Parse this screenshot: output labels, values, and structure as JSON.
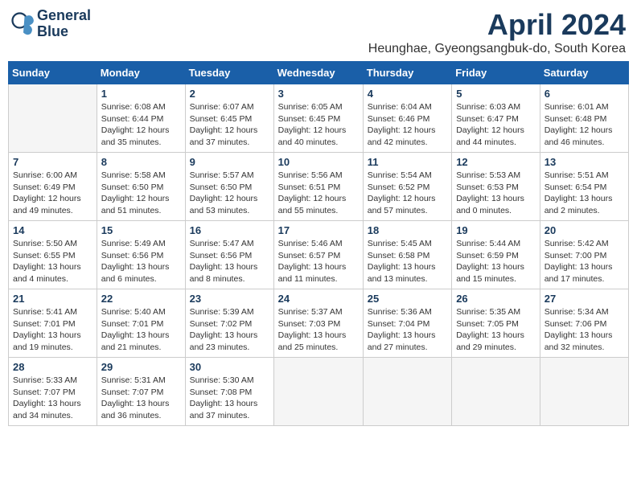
{
  "logo": {
    "line1": "General",
    "line2": "Blue"
  },
  "title": "April 2024",
  "location": "Heunghae, Gyeongsangbuk-do, South Korea",
  "days_of_week": [
    "Sunday",
    "Monday",
    "Tuesday",
    "Wednesday",
    "Thursday",
    "Friday",
    "Saturday"
  ],
  "weeks": [
    [
      {
        "day": "",
        "info": ""
      },
      {
        "day": "1",
        "info": "Sunrise: 6:08 AM\nSunset: 6:44 PM\nDaylight: 12 hours\nand 35 minutes."
      },
      {
        "day": "2",
        "info": "Sunrise: 6:07 AM\nSunset: 6:45 PM\nDaylight: 12 hours\nand 37 minutes."
      },
      {
        "day": "3",
        "info": "Sunrise: 6:05 AM\nSunset: 6:45 PM\nDaylight: 12 hours\nand 40 minutes."
      },
      {
        "day": "4",
        "info": "Sunrise: 6:04 AM\nSunset: 6:46 PM\nDaylight: 12 hours\nand 42 minutes."
      },
      {
        "day": "5",
        "info": "Sunrise: 6:03 AM\nSunset: 6:47 PM\nDaylight: 12 hours\nand 44 minutes."
      },
      {
        "day": "6",
        "info": "Sunrise: 6:01 AM\nSunset: 6:48 PM\nDaylight: 12 hours\nand 46 minutes."
      }
    ],
    [
      {
        "day": "7",
        "info": "Sunrise: 6:00 AM\nSunset: 6:49 PM\nDaylight: 12 hours\nand 49 minutes."
      },
      {
        "day": "8",
        "info": "Sunrise: 5:58 AM\nSunset: 6:50 PM\nDaylight: 12 hours\nand 51 minutes."
      },
      {
        "day": "9",
        "info": "Sunrise: 5:57 AM\nSunset: 6:50 PM\nDaylight: 12 hours\nand 53 minutes."
      },
      {
        "day": "10",
        "info": "Sunrise: 5:56 AM\nSunset: 6:51 PM\nDaylight: 12 hours\nand 55 minutes."
      },
      {
        "day": "11",
        "info": "Sunrise: 5:54 AM\nSunset: 6:52 PM\nDaylight: 12 hours\nand 57 minutes."
      },
      {
        "day": "12",
        "info": "Sunrise: 5:53 AM\nSunset: 6:53 PM\nDaylight: 13 hours\nand 0 minutes."
      },
      {
        "day": "13",
        "info": "Sunrise: 5:51 AM\nSunset: 6:54 PM\nDaylight: 13 hours\nand 2 minutes."
      }
    ],
    [
      {
        "day": "14",
        "info": "Sunrise: 5:50 AM\nSunset: 6:55 PM\nDaylight: 13 hours\nand 4 minutes."
      },
      {
        "day": "15",
        "info": "Sunrise: 5:49 AM\nSunset: 6:56 PM\nDaylight: 13 hours\nand 6 minutes."
      },
      {
        "day": "16",
        "info": "Sunrise: 5:47 AM\nSunset: 6:56 PM\nDaylight: 13 hours\nand 8 minutes."
      },
      {
        "day": "17",
        "info": "Sunrise: 5:46 AM\nSunset: 6:57 PM\nDaylight: 13 hours\nand 11 minutes."
      },
      {
        "day": "18",
        "info": "Sunrise: 5:45 AM\nSunset: 6:58 PM\nDaylight: 13 hours\nand 13 minutes."
      },
      {
        "day": "19",
        "info": "Sunrise: 5:44 AM\nSunset: 6:59 PM\nDaylight: 13 hours\nand 15 minutes."
      },
      {
        "day": "20",
        "info": "Sunrise: 5:42 AM\nSunset: 7:00 PM\nDaylight: 13 hours\nand 17 minutes."
      }
    ],
    [
      {
        "day": "21",
        "info": "Sunrise: 5:41 AM\nSunset: 7:01 PM\nDaylight: 13 hours\nand 19 minutes."
      },
      {
        "day": "22",
        "info": "Sunrise: 5:40 AM\nSunset: 7:01 PM\nDaylight: 13 hours\nand 21 minutes."
      },
      {
        "day": "23",
        "info": "Sunrise: 5:39 AM\nSunset: 7:02 PM\nDaylight: 13 hours\nand 23 minutes."
      },
      {
        "day": "24",
        "info": "Sunrise: 5:37 AM\nSunset: 7:03 PM\nDaylight: 13 hours\nand 25 minutes."
      },
      {
        "day": "25",
        "info": "Sunrise: 5:36 AM\nSunset: 7:04 PM\nDaylight: 13 hours\nand 27 minutes."
      },
      {
        "day": "26",
        "info": "Sunrise: 5:35 AM\nSunset: 7:05 PM\nDaylight: 13 hours\nand 29 minutes."
      },
      {
        "day": "27",
        "info": "Sunrise: 5:34 AM\nSunset: 7:06 PM\nDaylight: 13 hours\nand 32 minutes."
      }
    ],
    [
      {
        "day": "28",
        "info": "Sunrise: 5:33 AM\nSunset: 7:07 PM\nDaylight: 13 hours\nand 34 minutes."
      },
      {
        "day": "29",
        "info": "Sunrise: 5:31 AM\nSunset: 7:07 PM\nDaylight: 13 hours\nand 36 minutes."
      },
      {
        "day": "30",
        "info": "Sunrise: 5:30 AM\nSunset: 7:08 PM\nDaylight: 13 hours\nand 37 minutes."
      },
      {
        "day": "",
        "info": ""
      },
      {
        "day": "",
        "info": ""
      },
      {
        "day": "",
        "info": ""
      },
      {
        "day": "",
        "info": ""
      }
    ]
  ]
}
